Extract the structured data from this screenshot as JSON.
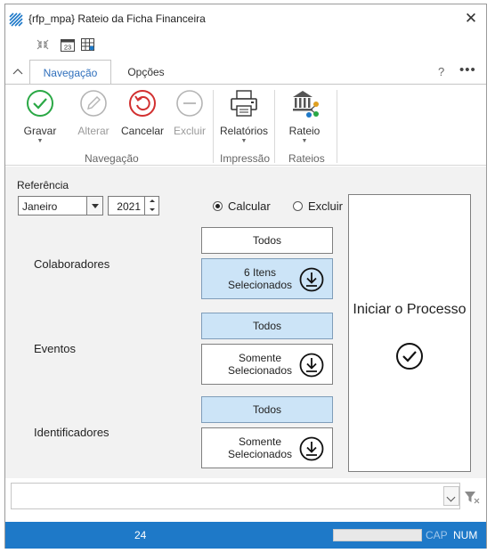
{
  "window": {
    "title": "{rfp_mpa}  Rateio da Ficha Financeira",
    "close_glyph": "✕"
  },
  "quick_access": {
    "icons": [
      "collapse-arrows-icon",
      "calendar-icon",
      "grid-settings-icon"
    ],
    "calendar_day": "23"
  },
  "ribbon": {
    "tabs": [
      {
        "label": "Navegação",
        "active": true
      },
      {
        "label": "Opções",
        "active": false
      }
    ],
    "help_label": "?",
    "more_label": "•••",
    "groups": [
      {
        "label": "Navegação",
        "buttons": [
          {
            "label": "Gravar",
            "icon": "check-circle-icon",
            "enabled": true,
            "dropdown": true
          },
          {
            "label": "Alterar",
            "icon": "pencil-icon",
            "enabled": false
          },
          {
            "label": "Cancelar",
            "icon": "undo-circle-icon",
            "enabled": true
          },
          {
            "label": "Excluir",
            "icon": "minus-circle-icon",
            "enabled": false
          }
        ]
      },
      {
        "label": "Impressão",
        "buttons": [
          {
            "label": "Relatórios",
            "icon": "printer-icon",
            "enabled": true,
            "dropdown": true
          }
        ]
      },
      {
        "label": "Rateios",
        "buttons": [
          {
            "label": "Rateio",
            "icon": "bank-distribution-icon",
            "enabled": true,
            "dropdown": true
          }
        ]
      }
    ]
  },
  "form": {
    "referencia_label": "Referência",
    "month_value": "Janeiro",
    "year_value": "2021",
    "mode_options": [
      {
        "label": "Calcular",
        "selected": true
      },
      {
        "label": "Excluir",
        "selected": false
      }
    ],
    "sections": [
      {
        "label": "Colaboradores",
        "todos_label": "Todos",
        "todos_selected": false,
        "selection_label": "6 Itens Selecionados",
        "selection_selected": true
      },
      {
        "label": "Eventos",
        "todos_label": "Todos",
        "todos_selected": true,
        "selection_label": "Somente Selecionados",
        "selection_selected": false
      },
      {
        "label": "Identificadores",
        "todos_label": "Todos",
        "todos_selected": true,
        "selection_label": "Somente Selecionados",
        "selection_selected": false
      }
    ],
    "start_button_label": "Iniciar o Processo"
  },
  "filter": {
    "value": ""
  },
  "status_bar": {
    "count": "24",
    "progress": 0,
    "cap_label": "CAP",
    "num_label": "NUM"
  },
  "colors": {
    "accent": "#2f6fbc",
    "status_bar": "#1e79c8",
    "selected_box": "#cce4f7",
    "content_bg": "#f2f2f2"
  }
}
